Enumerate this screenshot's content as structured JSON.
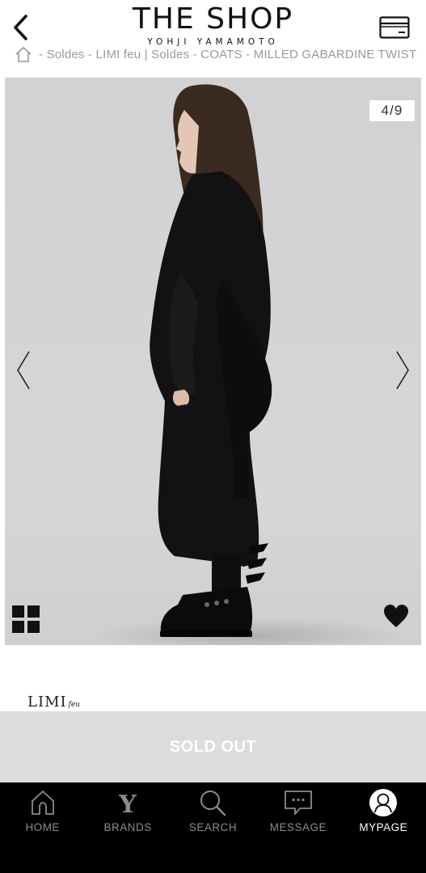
{
  "header": {
    "logo_title": "THE SHOP",
    "logo_subtitle": "YOHJI YAMAMOTO",
    "back_icon": "chevron-left-icon",
    "card_icon": "credit-card-icon"
  },
  "breadcrumb": {
    "text": "- Soldes - LIMI feu | Soldes - COATS - MILLED GABARDINE TWIST"
  },
  "gallery": {
    "counter": "4/9",
    "background": "#d4d4d6"
  },
  "brand": {
    "name": "LIMI",
    "suffix": "feu"
  },
  "purchase": {
    "sold_out_label": "SOLD OUT"
  },
  "tabbar": {
    "items": [
      {
        "label": "HOME",
        "icon": "home-icon"
      },
      {
        "label": "BRANDS",
        "icon": "brands-y-icon"
      },
      {
        "label": "SEARCH",
        "icon": "search-icon"
      },
      {
        "label": "MESSAGE",
        "icon": "message-icon"
      },
      {
        "label": "MYPAGE",
        "icon": "user-icon"
      }
    ],
    "active": "MYPAGE"
  },
  "colors": {
    "sold_out_bg": "#dcdcdc",
    "tabbar_bg": "#000000",
    "tab_inactive": "#8c8c8c",
    "tab_active": "#ffffff"
  }
}
